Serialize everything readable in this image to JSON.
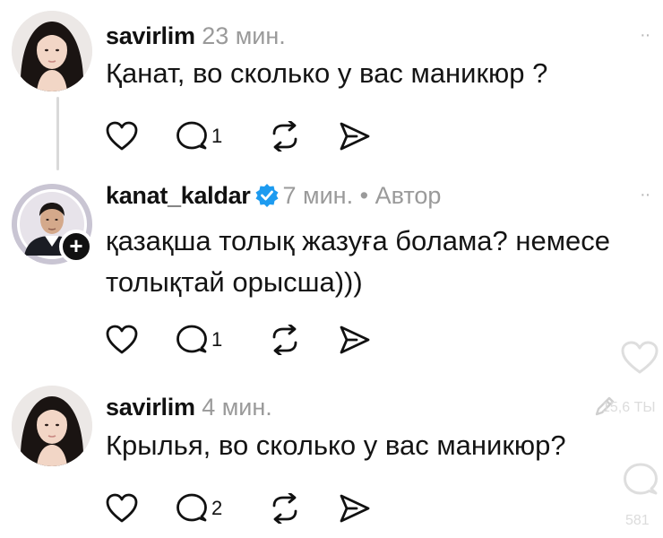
{
  "comments": [
    {
      "username": "savirlim",
      "time": "23 мин.",
      "author_tag": "",
      "text_lines": [
        "Қанат, во сколько у вас маникюр ?"
      ],
      "reply_count": "1",
      "more_icon": "ellipsis-icon"
    },
    {
      "username": "kanat_kaldar",
      "time": "7 мин.",
      "author_tag": "Автор",
      "verified": true,
      "text_lines": [
        "қазақша толық жазуға болама? немесе",
        "толықтай орысша)))"
      ],
      "reply_count": "1",
      "more_icon": "ellipsis-icon"
    },
    {
      "username": "savirlim",
      "time": "4 мин.",
      "author_tag": "",
      "text_lines": [
        "Крылья, во сколько у вас маникюр?"
      ],
      "reply_count": "2"
    }
  ],
  "separator": "•",
  "more_glyph": "··",
  "side_overlay": {
    "likes_label": "15,6 ТЫ",
    "comments_label": "581",
    "icons": [
      "heart-icon",
      "edit-icon",
      "comment-icon"
    ]
  },
  "colors": {
    "text": "#111111",
    "meta": "#9a9a9a",
    "verified": "#1d9bf0",
    "thread_line": "#d9d9d9"
  }
}
